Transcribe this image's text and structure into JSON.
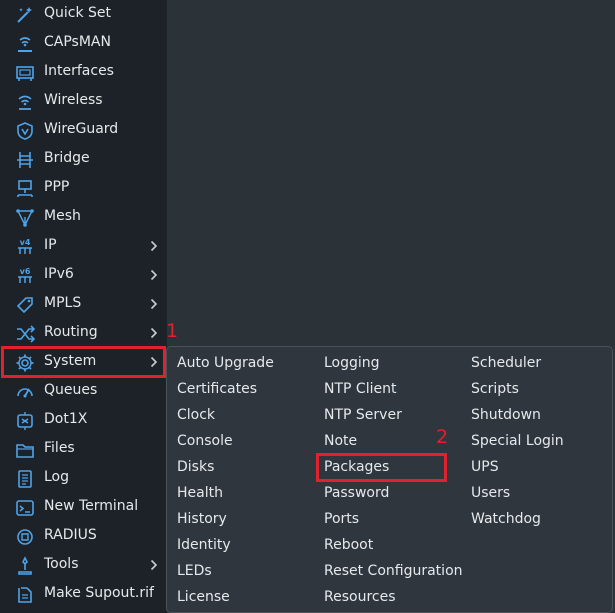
{
  "sidebar": {
    "items": [
      {
        "label": "Quick Set",
        "icon": "wand-icon",
        "has_submenu": false
      },
      {
        "label": "CAPsMAN",
        "icon": "antenna-icon",
        "has_submenu": false
      },
      {
        "label": "Interfaces",
        "icon": "ethernet-card-icon",
        "has_submenu": false
      },
      {
        "label": "Wireless",
        "icon": "wireless-icon",
        "has_submenu": false
      },
      {
        "label": "WireGuard",
        "icon": "wireguard-shield-icon",
        "has_submenu": false
      },
      {
        "label": "Bridge",
        "icon": "bridge-icon",
        "has_submenu": false
      },
      {
        "label": "PPP",
        "icon": "ppp-icon",
        "has_submenu": false
      },
      {
        "label": "Mesh",
        "icon": "mesh-icon",
        "has_submenu": false
      },
      {
        "label": "IP",
        "icon": "ipv4-icon",
        "has_submenu": true
      },
      {
        "label": "IPv6",
        "icon": "ipv6-icon",
        "has_submenu": true
      },
      {
        "label": "MPLS",
        "icon": "tag-icon",
        "has_submenu": true
      },
      {
        "label": "Routing",
        "icon": "routing-shuffle-icon",
        "has_submenu": true
      },
      {
        "label": "System",
        "icon": "gear-icon",
        "has_submenu": true
      },
      {
        "label": "Queues",
        "icon": "gauge-icon",
        "has_submenu": false
      },
      {
        "label": "Dot1X",
        "icon": "dot1x-icon",
        "has_submenu": false
      },
      {
        "label": "Files",
        "icon": "folder-icon",
        "has_submenu": false
      },
      {
        "label": "Log",
        "icon": "log-icon",
        "has_submenu": false
      },
      {
        "label": "New Terminal",
        "icon": "terminal-icon",
        "has_submenu": false
      },
      {
        "label": "RADIUS",
        "icon": "radius-icon",
        "has_submenu": false
      },
      {
        "label": "Tools",
        "icon": "tools-icon",
        "has_submenu": true
      },
      {
        "label": "Make Supout.rif",
        "icon": "supout-icon",
        "has_submenu": false
      }
    ]
  },
  "submenu": {
    "columns": [
      [
        "Auto Upgrade",
        "Certificates",
        "Clock",
        "Console",
        "Disks",
        "Health",
        "History",
        "Identity",
        "LEDs",
        "License"
      ],
      [
        "Logging",
        "NTP Client",
        "NTP Server",
        "Note",
        "Packages",
        "Password",
        "Ports",
        "Reboot",
        "Reset Configuration",
        "Resources"
      ],
      [
        "Scheduler",
        "Scripts",
        "Shutdown",
        "Special Login",
        "UPS",
        "Users",
        "Watchdog"
      ]
    ]
  },
  "annotations": {
    "step1": "1",
    "step2": "2",
    "color": "#e0212e"
  },
  "colors": {
    "sidebar_bg": "#1c2227",
    "content_bg": "#2b3238",
    "submenu_bg": "#2f363d",
    "icon_color": "#4fa3e8",
    "text": "#e6e9ec"
  }
}
